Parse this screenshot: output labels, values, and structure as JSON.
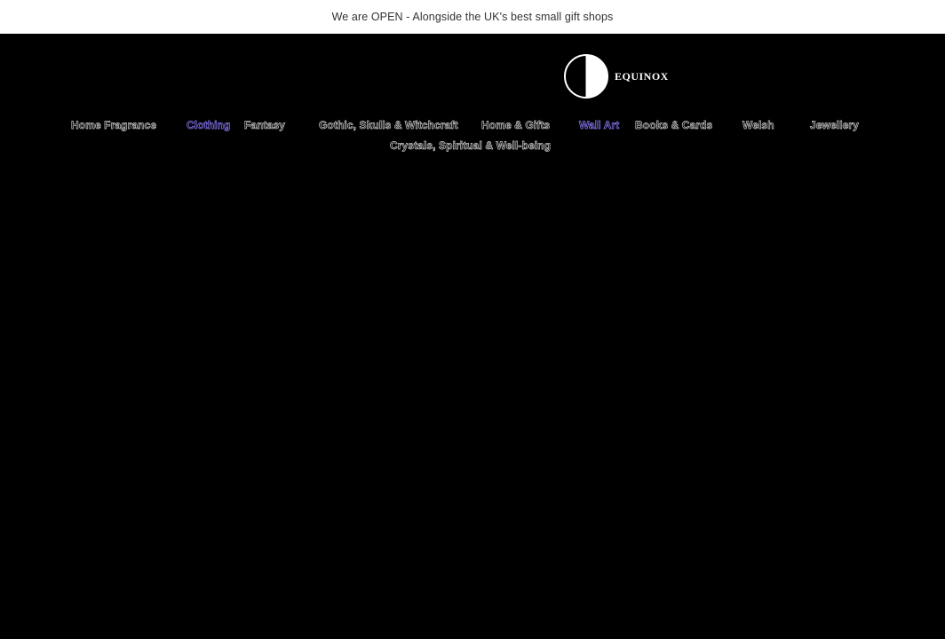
{
  "announcement": {
    "text": "We are OPEN - Alongside the UK's best small gift shops"
  },
  "logo": {
    "text": "EQUINOX",
    "icon": "half-moon-icon"
  },
  "nav": {
    "items": [
      {
        "label": "Home Fragrance"
      },
      {
        "label": "Clothing",
        "accent": "#8a7cff"
      },
      {
        "label": "Fantasy"
      },
      {
        "label": "Gothic, Skulls & Witchcraft"
      },
      {
        "label": "Home & Gifts"
      },
      {
        "label": "Wall Art",
        "accent": "#8a7cff"
      },
      {
        "label": "Books & Cards"
      },
      {
        "label": "Welsh"
      },
      {
        "label": "Jewellery"
      },
      {
        "label": "Crystals, Spiritual & Well-being"
      }
    ]
  },
  "colors": {
    "page_background": "#000000",
    "announcement_background": "#ffffff",
    "nav_outline": "#c9c9c9",
    "nav_accent": "#8a7cff"
  }
}
